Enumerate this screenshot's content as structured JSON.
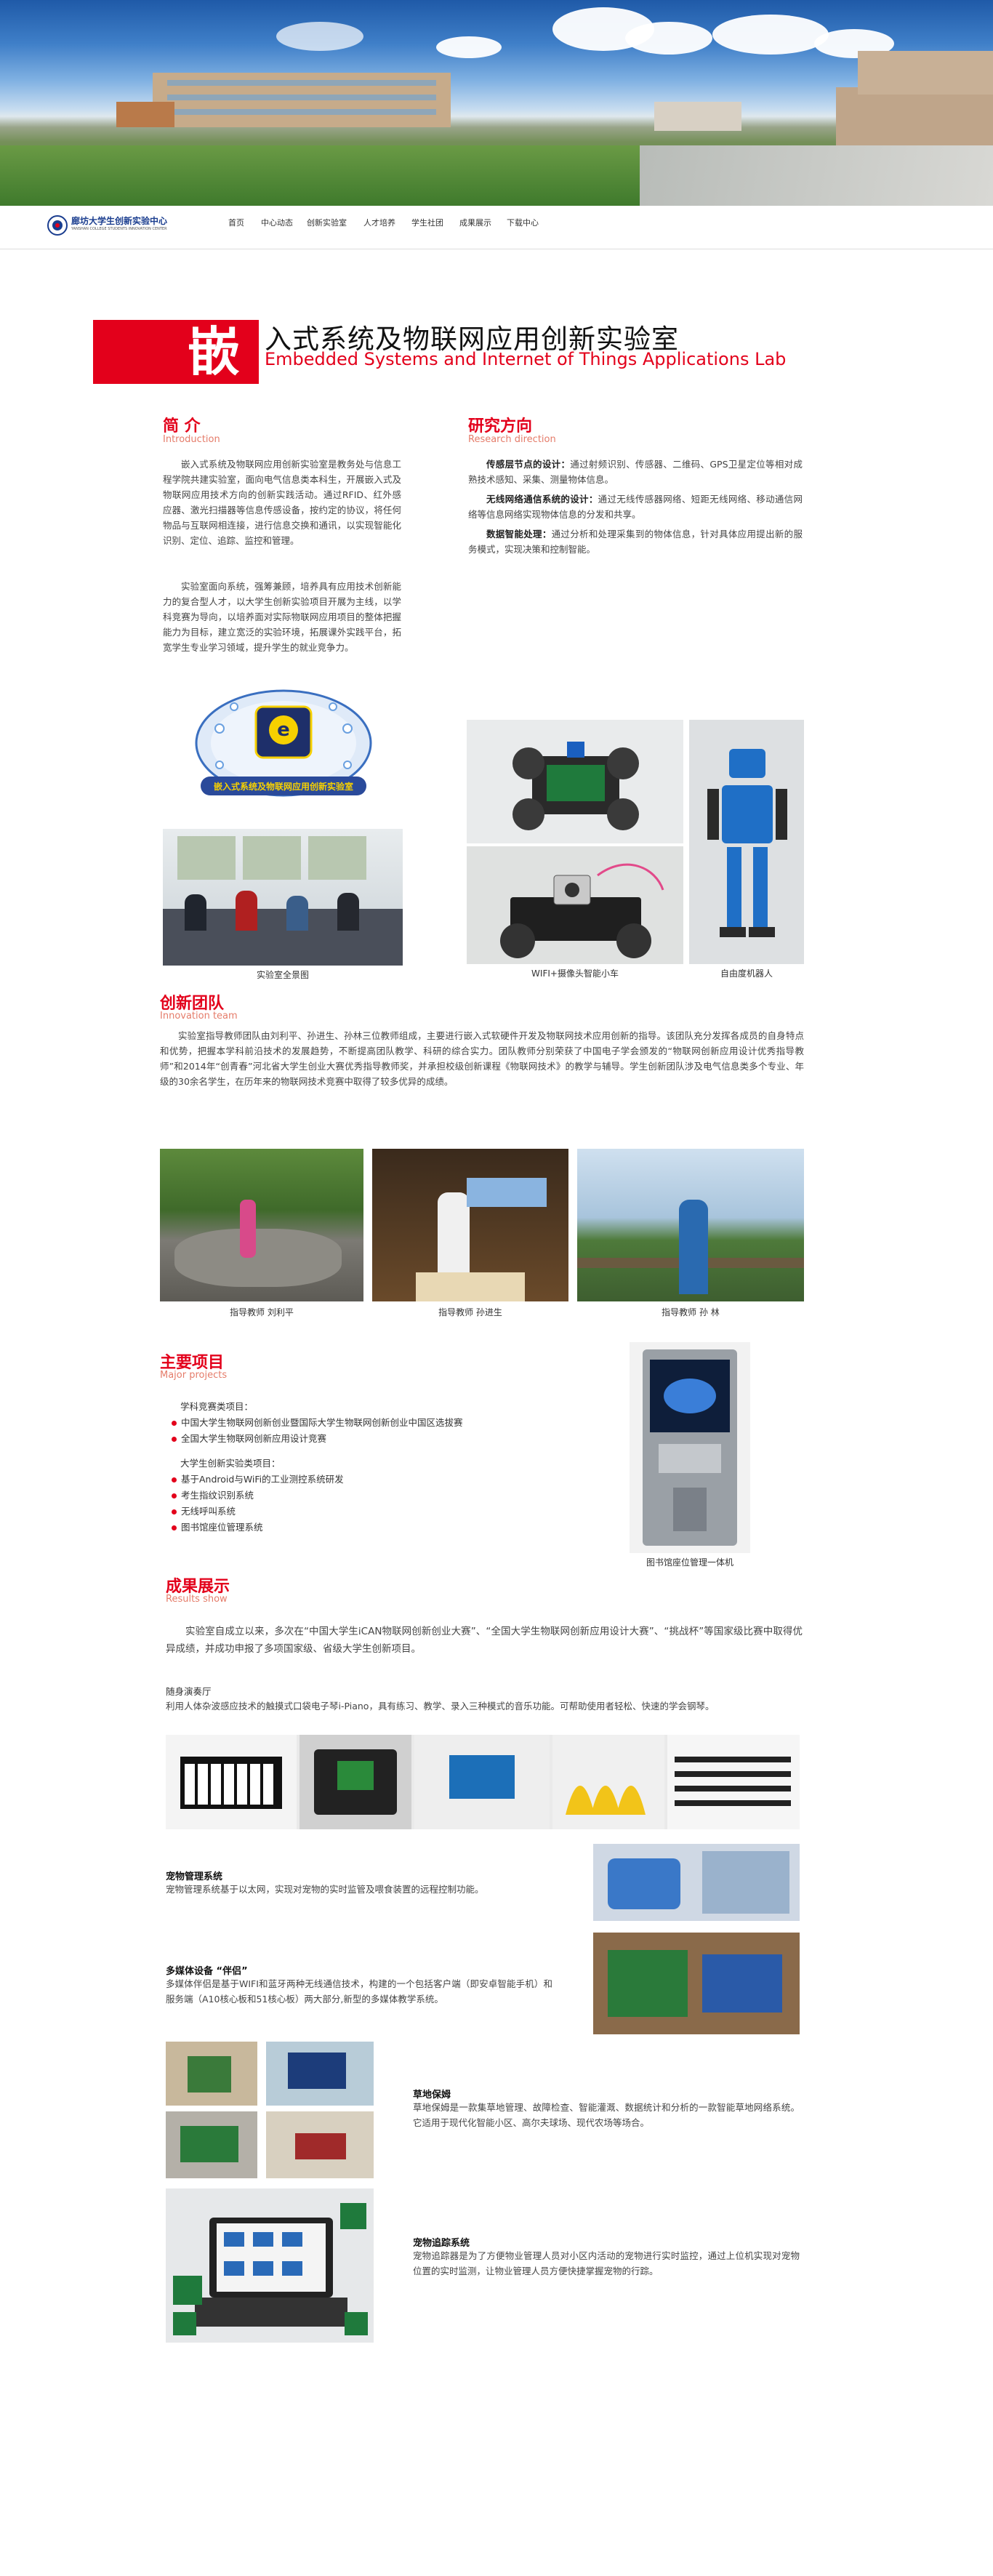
{
  "header": {
    "logo_cn": "廊坊大学生创新实验中心",
    "logo_en": "YANSHAN COLLEGE STUDENTS INNOVATION CENTER",
    "nav": [
      "首页",
      "中心动态",
      "创新实验室",
      "人才培养",
      "学生社团",
      "成果展示",
      "下载中心"
    ]
  },
  "title": {
    "glyph": "嵌",
    "cn": "入式系统及物联网应用创新实验室",
    "en": "Embedded Systems and Internet of Things Applications Lab"
  },
  "intro": {
    "cn": "简  介",
    "en": "Introduction",
    "p1": "嵌入式系统及物联网应用创新实验室是教务处与信息工程学院共建实验室，面向电气信息类本科生，开展嵌入式及物联网应用技术方向的创新实践活动。通过RFID、红外感应器、激光扫描器等信息传感设备，按约定的协议，将任何物品与互联网相连接，进行信息交换和通讯，以实现智能化识别、定位、追踪、监控和管理。",
    "p2": "实验室面向系统，强筹兼顾，培养具有应用技术创新能力的复合型人才，以大学生创新实验项目开展为主线，以学科竞赛为导向，以培养面对实际物联网应用项目的整体把握能力为目标，建立宽泛的实验环境，拓展课外实践平台，拓宽学生专业学习领域，提升学生的就业竞争力。"
  },
  "research": {
    "cn": "研究方向",
    "en": "Research direction",
    "items": [
      {
        "head": "传感层节点的设计：",
        "text": "通过射频识别、传感器、二维码、GPS卫星定位等相对成熟技术感知、采集、测量物体信息。"
      },
      {
        "head": "无线网络通信系统的设计：",
        "text": "通过无线传感器网络、短距无线网络、移动通信网络等信息网络实现物体信息的分发和共享。"
      },
      {
        "head": "数据智能处理：",
        "text": "通过分析和处理采集到的物体信息，针对具体应用提出新的服务模式，实现决策和控制智能。"
      }
    ]
  },
  "photos1": {
    "badge_text": "嵌入式系统及物联网应用创新实验室",
    "cap_lab": "实验室全景图",
    "cap_car": "WIFI+摄像头智能小车",
    "cap_robot": "自由度机器人"
  },
  "team": {
    "cn": "创新团队",
    "en": "Innovation team",
    "text": "实验室指导教师团队由刘利平、孙进生、孙林三位教师组成，主要进行嵌入式软硬件开发及物联网技术应用创新的指导。该团队充分发挥各成员的自身特点和优势，把握本学科前沿技术的发展趋势，不断提高团队教学、科研的综合实力。团队教师分别荣获了中国电子学会颁发的“物联网创新应用设计优秀指导教师”和2014年“创青春”河北省大学生创业大赛优秀指导教师奖，并承担校级创新课程《物联网技术》的教学与辅导。学生创新团队涉及电气信息类多个专业、年级的30余名学生，在历年来的物联网技术竞赛中取得了较多优异的成绩。",
    "caps": [
      "指导教师  刘利平",
      "指导教师  孙进生",
      "指导教师  孙  林"
    ]
  },
  "projects": {
    "cn": "主要项目",
    "en": "Major projects",
    "group1": "学科竞赛类项目：",
    "list1": [
      "中国大学生物联网创新创业暨国际大学生物联网创新创业中国区选拔赛",
      "全国大学生物联网创新应用设计竞赛"
    ],
    "group2": "大学生创新实验类项目：",
    "list2": [
      "基于Android与WiFi的工业测控系统研发",
      "考生指纹识别系统",
      "无线呼叫系统",
      "图书馆座位管理系统"
    ],
    "kiosk_cap": "图书馆座位管理一体机"
  },
  "results": {
    "cn": "成果展示",
    "en": "Results show",
    "text": "实验室自成立以来，多次在“中国大学生iCAN物联网创新创业大赛”、“全国大学生物联网创新应用设计大赛”、“挑战杯”等国家级比赛中取得优异成绩，并成功申报了多项国家级、省级大学生创新项目。",
    "items": [
      {
        "title": "随身演奏厅",
        "desc": "利用人体杂波感应技术的触摸式口袋电子琴i-Piano，具有练习、教学、录入三种模式的音乐功能。可帮助使用者轻松、快速的学会钢琴。"
      },
      {
        "title": "宠物管理系统",
        "desc": "宠物管理系统基于以太网，实现对宠物的实时监管及喂食装置的远程控制功能。"
      },
      {
        "title": "多媒体设备 “伴侣”",
        "desc": "多媒体伴侣是基于WIFI和蓝牙两种无线通信技术，构建的一个包括客户端（即安卓智能手机）和服务端（A10核心板和51核心板）两大部分,新型的多媒体教学系统。"
      },
      {
        "title": "草地保姆",
        "desc": "草地保姆是一款集草地管理、故障检查、智能灌溉、数据统计和分析的一款智能草地网络系统。它适用于现代化智能小区、高尔夫球场、现代农场等场合。"
      },
      {
        "title": "宠物追踪系统",
        "desc": "宠物追踪器是为了方便物业管理人员对小区内活动的宠物进行实时监控，通过上位机实现对宠物位置的实时监测，让物业管理人员方便快捷掌握宠物的行踪。"
      }
    ]
  },
  "colors": {
    "accent": "#e3001b",
    "accent_light": "#e57c6a",
    "text": "#444444"
  }
}
